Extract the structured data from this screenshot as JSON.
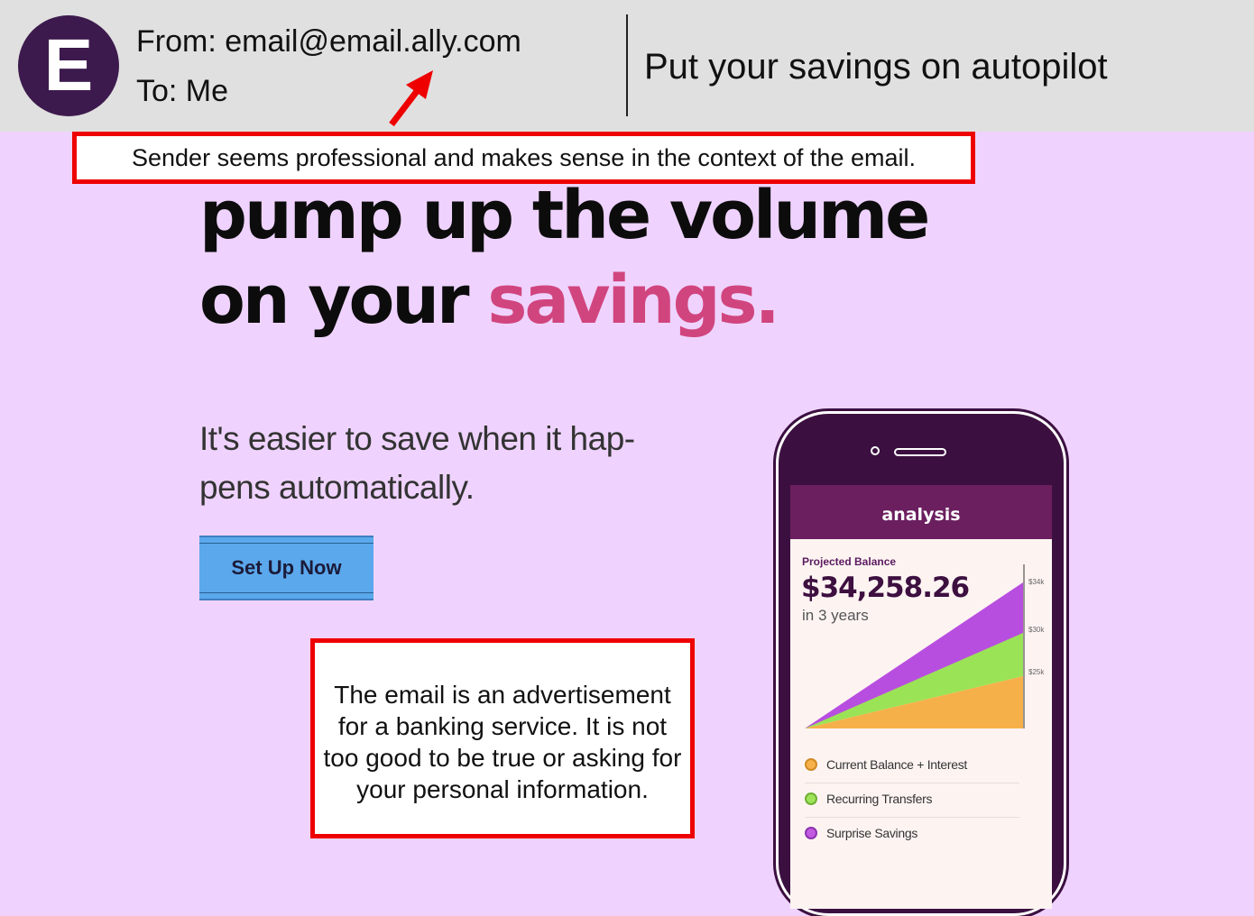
{
  "email": {
    "avatar_letter": "E",
    "from": "From: email@email.ally.com",
    "to": "To: Me",
    "subject": "Put your savings on autopilot"
  },
  "annotations": {
    "sender_note": "Sender seems professional and makes sense in the context of the email.",
    "content_note": "The email is an advertisement for a banking service. It is not too good to be true or asking for your personal information."
  },
  "hero": {
    "headline_line1": "pump up the volume",
    "headline_line2_prefix": "on your ",
    "headline_line2_highlight": "savings.",
    "lead_line1": "It's easier to save when it hap-",
    "lead_line2": "pens automatically.",
    "cta_label": "Set Up Now"
  },
  "phone_app": {
    "title": "analysis",
    "projected_label": "Projected Balance",
    "projected_value": "$34,258.26",
    "projected_sub": "in 3 years",
    "y_ticks": [
      "$34k",
      "$30k",
      "$25k"
    ],
    "legend": [
      {
        "label": "Current Balance + Interest",
        "color": "#f7b14a"
      },
      {
        "label": "Recurring Transfers",
        "color": "#9ee35a"
      },
      {
        "label": "Surprise Savings",
        "color": "#c15ce0"
      }
    ]
  },
  "colors": {
    "background": "#efd3fe",
    "header": "#e0e0e0",
    "avatar": "#3d1a4d",
    "highlight_pink": "#d1457f",
    "cta": "#5ba8ec",
    "annotation_border": "#ee0000",
    "phone_bar": "#6b1f5f"
  }
}
